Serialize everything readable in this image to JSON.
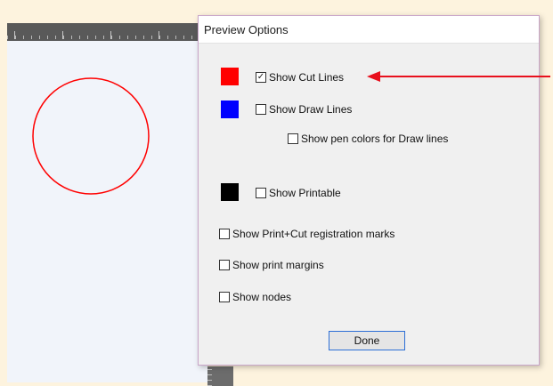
{
  "dialog": {
    "title": "Preview Options",
    "options": {
      "show_cut_lines": {
        "label": "Show Cut Lines",
        "checked": true,
        "swatch_color": "#ff0000"
      },
      "show_draw_lines": {
        "label": "Show Draw Lines",
        "checked": false,
        "swatch_color": "#0000ff"
      },
      "show_pen_colors": {
        "label": "Show pen colors for Draw lines",
        "checked": false
      },
      "show_printable": {
        "label": "Show Printable",
        "checked": false,
        "swatch_color": "#000000"
      },
      "show_registration_marks": {
        "label": "Show Print+Cut registration marks",
        "checked": false
      },
      "show_print_margins": {
        "label": "Show print margins",
        "checked": false
      },
      "show_nodes": {
        "label": "Show nodes",
        "checked": false
      }
    },
    "done_label": "Done"
  },
  "colors": {
    "cut_circle": "#ff0000",
    "annotation_arrow": "#e8101d",
    "focus_border": "#2d6fd6"
  }
}
